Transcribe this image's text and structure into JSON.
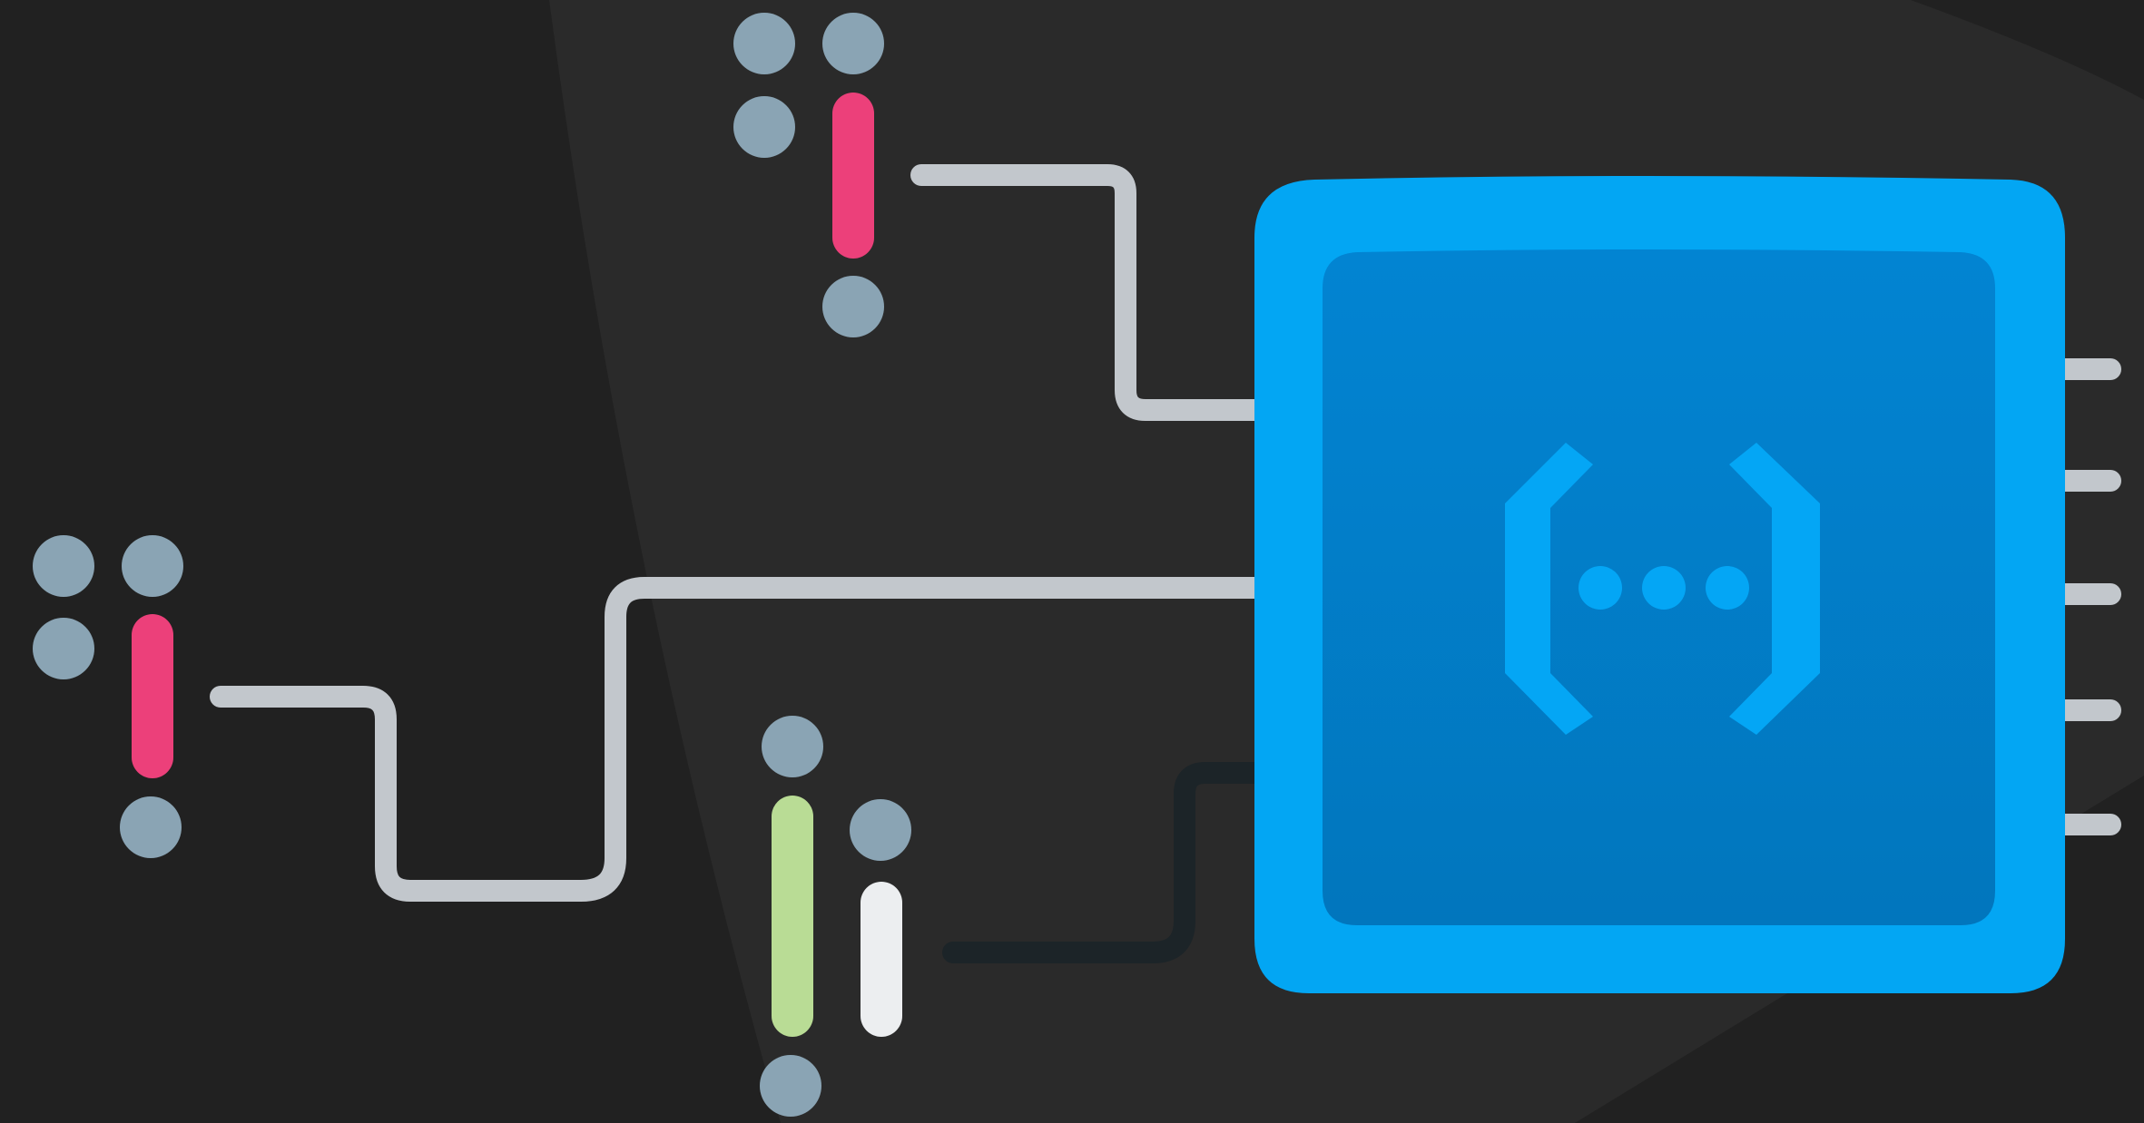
{
  "scene": {
    "subject": "cloud-functions-illustration",
    "colors": {
      "background_dark": "#212121",
      "background_light": "#2a2a2a",
      "chip_outer": "#03a6f3",
      "chip_inner": "#0182cf",
      "chip_inner_bottom": "#0178c0",
      "chip_symbol": "#04a6f5",
      "pins": "#c2c7cc",
      "wire_light": "#c2c7cc",
      "wire_dark": "#1c2428",
      "dot": "#8aa4b4",
      "bar_pink": "#ec407a",
      "bar_green": "#b9dc95",
      "bar_white": "#eceef0"
    },
    "icons": {
      "chip": "function-chip-icon",
      "symbol": "braces-ellipsis-icon"
    },
    "glyph_groups": [
      {
        "name": "top-signal",
        "bar_color": "pink"
      },
      {
        "name": "left-signal",
        "bar_color": "pink"
      },
      {
        "name": "bottom-signal",
        "bar_colors": [
          "green",
          "white"
        ]
      }
    ],
    "pin_count": 5,
    "wire_count": 3
  }
}
